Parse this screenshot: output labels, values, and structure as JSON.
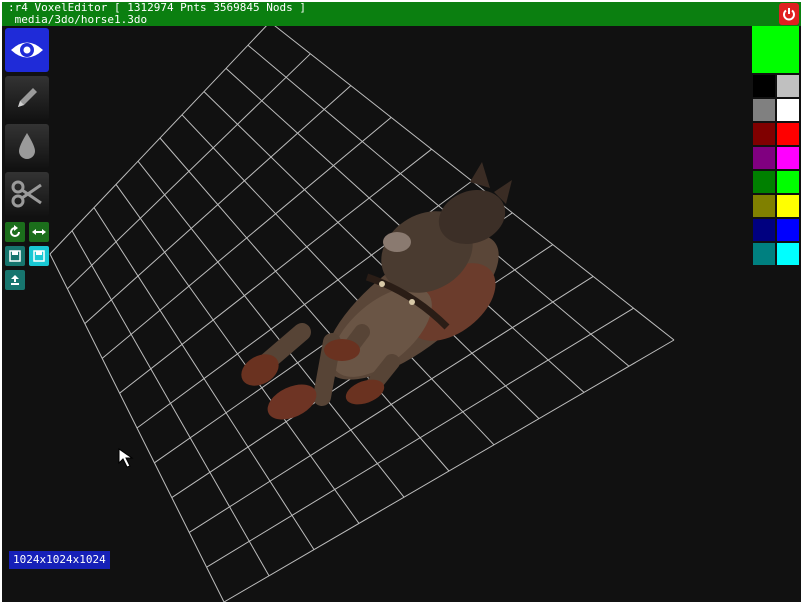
{
  "app": {
    "title_line1": ":r4 VoxelEditor [ 1312974 Pnts 3569845 Nods ]",
    "title_line2": " media/3do/horse1.3do"
  },
  "toolbar": {
    "tools": [
      {
        "name": "view",
        "icon": "eye-icon",
        "active": true
      },
      {
        "name": "draw",
        "icon": "pencil-icon",
        "active": false
      },
      {
        "name": "fill",
        "icon": "drop-icon",
        "active": false
      },
      {
        "name": "cut",
        "icon": "scissors-icon",
        "active": false
      }
    ],
    "small_buttons": [
      {
        "name": "rotate",
        "icon": "rotate-icon"
      },
      {
        "name": "flip",
        "icon": "flip-horizontal-icon"
      },
      {
        "name": "save",
        "icon": "save-icon"
      },
      {
        "name": "save-as",
        "icon": "save-icon"
      },
      {
        "name": "export",
        "icon": "upload-icon"
      }
    ]
  },
  "palette": {
    "current": "#00ff00",
    "colors": [
      "#000000",
      "#c0c0c0",
      "#808080",
      "#ffffff",
      "#800000",
      "#ff0000",
      "#800080",
      "#ff00ff",
      "#008000",
      "#00ff00",
      "#808000",
      "#ffff00",
      "#000080",
      "#0000ff",
      "#008080",
      "#00ffff"
    ]
  },
  "status": {
    "resolution": "1024x1024x1024"
  },
  "colors": {
    "titlebar": "#0b7f10",
    "active_tool": "#1f2bd8",
    "status_bg": "#1620b8",
    "power": "#e02020"
  }
}
